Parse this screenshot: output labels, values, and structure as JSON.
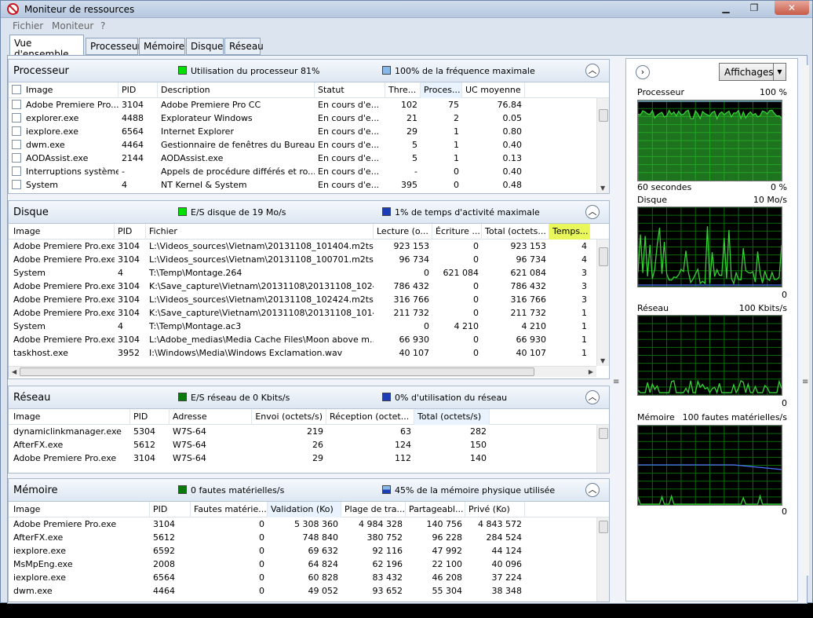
{
  "window": {
    "title": "Moniteur de ressources"
  },
  "menu": [
    "Fichier",
    "Moniteur",
    "?"
  ],
  "tabs": [
    "Vue d'ensemble",
    "Processeur",
    "Mémoire",
    "Disque",
    "Réseau"
  ],
  "colors": {
    "green": "#00c000",
    "blue": "#1c3db6",
    "lightblue": "#88b8e8",
    "graph_green": "#36d336",
    "grid": "#0a6b0a",
    "graph_blue": "#4a6fff"
  },
  "cpu": {
    "title": "Processeur",
    "stat1": "Utilisation du processeur 81%",
    "stat2": "100% de la fréquence maximale",
    "headers": [
      "Image",
      "PID",
      "Description",
      "Statut",
      "Thre...",
      "Proces...",
      "UC moyenne"
    ],
    "rows": [
      [
        "Adobe Premiere Pro....",
        "3104",
        "Adobe Premiere Pro CC",
        "En cours d'e...",
        "102",
        "75",
        "76.84"
      ],
      [
        "explorer.exe",
        "4488",
        "Explorateur Windows",
        "En cours d'e...",
        "21",
        "2",
        "0.05"
      ],
      [
        "iexplore.exe",
        "6564",
        "Internet Explorer",
        "En cours d'e...",
        "29",
        "1",
        "0.80"
      ],
      [
        "dwm.exe",
        "4464",
        "Gestionnaire de fenêtres du Bureau",
        "En cours d'e...",
        "5",
        "1",
        "0.40"
      ],
      [
        "AODAssist.exe",
        "2144",
        "AODAssist.exe",
        "En cours d'e...",
        "5",
        "1",
        "0.13"
      ],
      [
        "Interruptions système",
        "-",
        "Appels de procédure différés et ro...",
        "En cours d'e...",
        "-",
        "0",
        "0.40"
      ],
      [
        "System",
        "4",
        "NT Kernel & System",
        "En cours d'e...",
        "395",
        "0",
        "0.48"
      ]
    ]
  },
  "disk": {
    "title": "Disque",
    "stat1": "E/S disque de 19 Mo/s",
    "stat2": "1% de temps d'activité maximale",
    "headers": [
      "Image",
      "PID",
      "Fichier",
      "Lecture (o...",
      "Écriture ...",
      "Total (octets...",
      "Temps..."
    ],
    "rows": [
      [
        "Adobe Premiere Pro.exe",
        "3104",
        "L:\\Videos_sources\\Vietnam\\20131108_101404.m2ts",
        "923 153",
        "0",
        "923 153",
        "4"
      ],
      [
        "Adobe Premiere Pro.exe",
        "3104",
        "L:\\Videos_sources\\Vietnam\\20131108_100701.m2ts",
        "96 734",
        "0",
        "96 734",
        "4"
      ],
      [
        "System",
        "4",
        "T:\\Temp\\Montage.264",
        "0",
        "621 084",
        "621 084",
        "3"
      ],
      [
        "Adobe Premiere Pro.exe",
        "3104",
        "K:\\Save_capture\\Vietnam\\20131108\\20131108_10242...",
        "786 432",
        "0",
        "786 432",
        "3"
      ],
      [
        "Adobe Premiere Pro.exe",
        "3104",
        "L:\\Videos_sources\\Vietnam\\20131108_102424.m2ts",
        "316 766",
        "0",
        "316 766",
        "3"
      ],
      [
        "Adobe Premiere Pro.exe",
        "3104",
        "K:\\Save_capture\\Vietnam\\20131108\\20131108_10140...",
        "211 732",
        "0",
        "211 732",
        "1"
      ],
      [
        "System",
        "4",
        "T:\\Temp\\Montage.ac3",
        "0",
        "4 210",
        "4 210",
        "1"
      ],
      [
        "Adobe Premiere Pro.exe",
        "3104",
        "L:\\Adobe_medias\\Media Cache Files\\Moon above m...",
        "66 930",
        "0",
        "66 930",
        "1"
      ],
      [
        "taskhost.exe",
        "3952",
        "I:\\Windows\\Media\\Windows Exclamation.wav",
        "40 107",
        "0",
        "40 107",
        "1"
      ]
    ]
  },
  "net": {
    "title": "Réseau",
    "stat1": "E/S réseau de 0 Kbits/s",
    "stat2": "0% d'utilisation du réseau",
    "headers": [
      "Image",
      "PID",
      "Adresse",
      "Envoi (octets/s)",
      "Réception (octet...",
      "Total (octets/s)"
    ],
    "rows": [
      [
        "dynamiclinkmanager.exe",
        "5304",
        "W7S-64",
        "219",
        "63",
        "282"
      ],
      [
        "AfterFX.exe",
        "5612",
        "W7S-64",
        "26",
        "124",
        "150"
      ],
      [
        "Adobe Premiere Pro.exe",
        "3104",
        "W7S-64",
        "29",
        "112",
        "140"
      ]
    ]
  },
  "mem": {
    "title": "Mémoire",
    "stat1": "0 fautes matérielles/s",
    "stat2": "45% de la mémoire physique utilisée",
    "headers": [
      "Image",
      "PID",
      "Fautes matérie...",
      "Validation (Ko)",
      "Plage de tra...",
      "Partageabl...",
      "Privé (Ko)"
    ],
    "rows": [
      [
        "Adobe Premiere Pro.exe",
        "3104",
        "0",
        "5 308 360",
        "4 984 328",
        "140 756",
        "4 843 572"
      ],
      [
        "AfterFX.exe",
        "5612",
        "0",
        "748 840",
        "380 752",
        "96 228",
        "284 524"
      ],
      [
        "iexplore.exe",
        "6592",
        "0",
        "69 632",
        "92 116",
        "47 992",
        "44 124"
      ],
      [
        "MsMpEng.exe",
        "2008",
        "0",
        "64 824",
        "62 196",
        "22 100",
        "40 096"
      ],
      [
        "iexplore.exe",
        "6564",
        "0",
        "60 828",
        "83 432",
        "46 208",
        "37 224"
      ],
      [
        "dwm.exe",
        "4464",
        "0",
        "49 052",
        "93 652",
        "55 304",
        "38 348"
      ]
    ]
  },
  "side": {
    "views_label": "Affichages",
    "graphs": [
      {
        "name": "Processeur",
        "max": "100 %",
        "foot_left": "60 secondes",
        "foot_right": "0 %"
      },
      {
        "name": "Disque",
        "max": "10 Mo/s",
        "foot_left": "",
        "foot_right": "0"
      },
      {
        "name": "Réseau",
        "max": "100 Kbits/s",
        "foot_left": "",
        "foot_right": "0"
      },
      {
        "name": "Mémoire",
        "max": "100 fautes matérielles/s",
        "foot_left": "",
        "foot_right": "0"
      }
    ]
  }
}
